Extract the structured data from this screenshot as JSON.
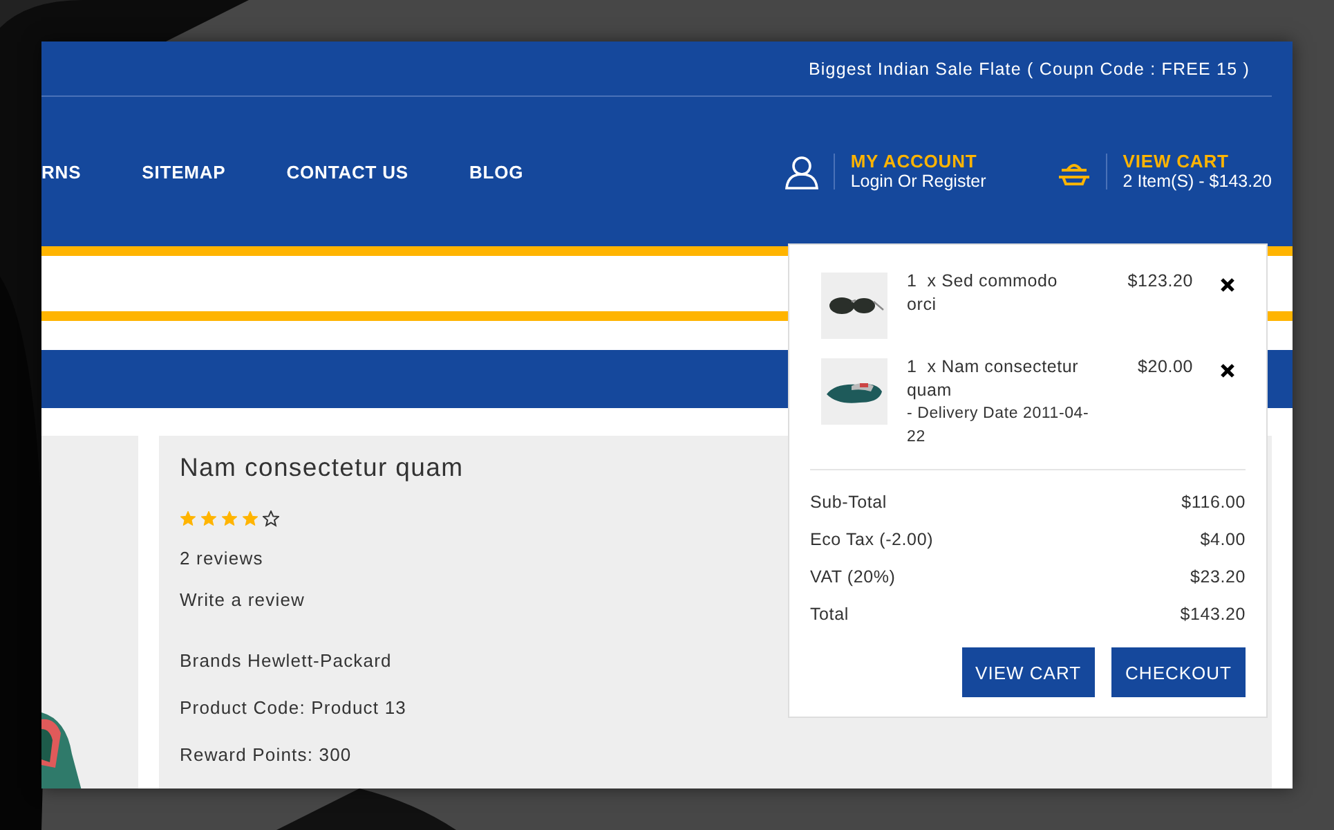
{
  "top_bar": {
    "promo": "Biggest Indian Sale Flate ( Coupn Code : FREE 15 )"
  },
  "nav": {
    "items": [
      {
        "label": "RNS"
      },
      {
        "label": "SITEMAP"
      },
      {
        "label": "CONTACT US"
      },
      {
        "label": "BLOG"
      }
    ]
  },
  "account": {
    "title": "MY ACCOUNT",
    "subtitle": "Login Or Register"
  },
  "cart_summary": {
    "title": "VIEW CART",
    "subtitle": "2 Item(S) - $143.20"
  },
  "product": {
    "name": "Nam consectetur quam",
    "stars": 4,
    "reviews": "2 reviews",
    "write_review": "Write a review",
    "details": [
      "Brands Hewlett-Packard",
      "Product Code: Product 13",
      "Reward Points: 300"
    ]
  },
  "cart_dropdown": {
    "items": [
      {
        "kind": "glasses",
        "name": "1  x Sed commodo orci",
        "price": "$123.20"
      },
      {
        "kind": "shoe",
        "name": "1  x Nam consectetur quam",
        "option": "- Delivery Date 2011-04-22",
        "price": "$20.00"
      }
    ],
    "totals": [
      {
        "label": "Sub-Total",
        "value": "$116.00"
      },
      {
        "label": "Eco Tax (-2.00)",
        "value": "$4.00"
      },
      {
        "label": "VAT (20%)",
        "value": "$23.20"
      },
      {
        "label": "Total",
        "value": "$143.20"
      }
    ],
    "buttons": [
      "VIEW CART",
      "CHECKOUT"
    ]
  }
}
